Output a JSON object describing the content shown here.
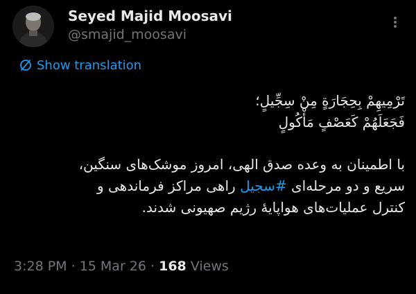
{
  "user": {
    "name": "Seyed Majid Moosavi",
    "handle": "@smajid_moosavi"
  },
  "translate": {
    "label": "Show translation"
  },
  "tweet": {
    "verse_line_1": "تَرْمِيهِمْ بِحِجَارَةٍ مِنْ سِجِّيلٍ؛",
    "verse_line_2": "فَجَعَلَهُمْ كَعَصْفٍ مَأْكُولٍ",
    "body_line_1": "با اطمینان به وعده صدق الهی، امروز موشک‌های سنگین،",
    "body_line_2_start": "سریع و دو مرحله‌ای ",
    "hashtag": "#سجیل",
    "body_line_2_end": " راهی مراکز فرماندهی و",
    "body_line_3": "کنترل عملیات‌های هوا‌پایهٔ رژیم صهیونی شدند."
  },
  "meta": {
    "time": "3:28 PM",
    "separator_1": " · ",
    "date": "15 Mar 26",
    "separator_2": " · ",
    "views_count": "168",
    "views_label": " Views"
  },
  "colors": {
    "background": "#000000",
    "text": "#e7e9ea",
    "secondary": "#71767b",
    "accent": "#1d9bf0"
  },
  "icons": {
    "more": "more-vertical-icon",
    "translate": "translate-icon"
  }
}
